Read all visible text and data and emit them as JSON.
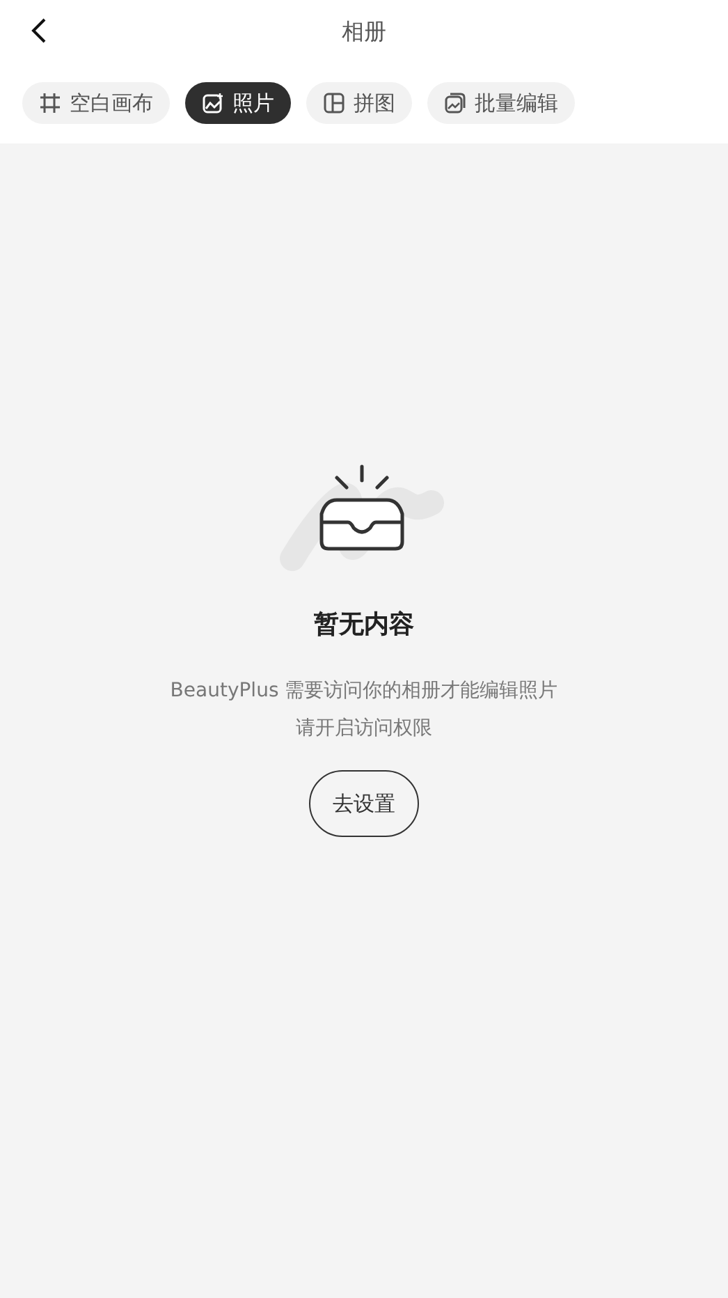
{
  "header": {
    "title": "相册"
  },
  "tabs": [
    {
      "label": "空白画布",
      "kind": "canvas",
      "selected": false
    },
    {
      "label": "照片",
      "kind": "photo",
      "selected": true
    },
    {
      "label": "拼图",
      "kind": "collage",
      "selected": false
    },
    {
      "label": "批量编辑",
      "kind": "batch",
      "selected": false
    }
  ],
  "empty_state": {
    "title": "暂无内容",
    "lines": [
      "BeautyPlus 需要访问你的相册才能编辑照片",
      "请开启访问权限"
    ],
    "button": "去设置"
  }
}
